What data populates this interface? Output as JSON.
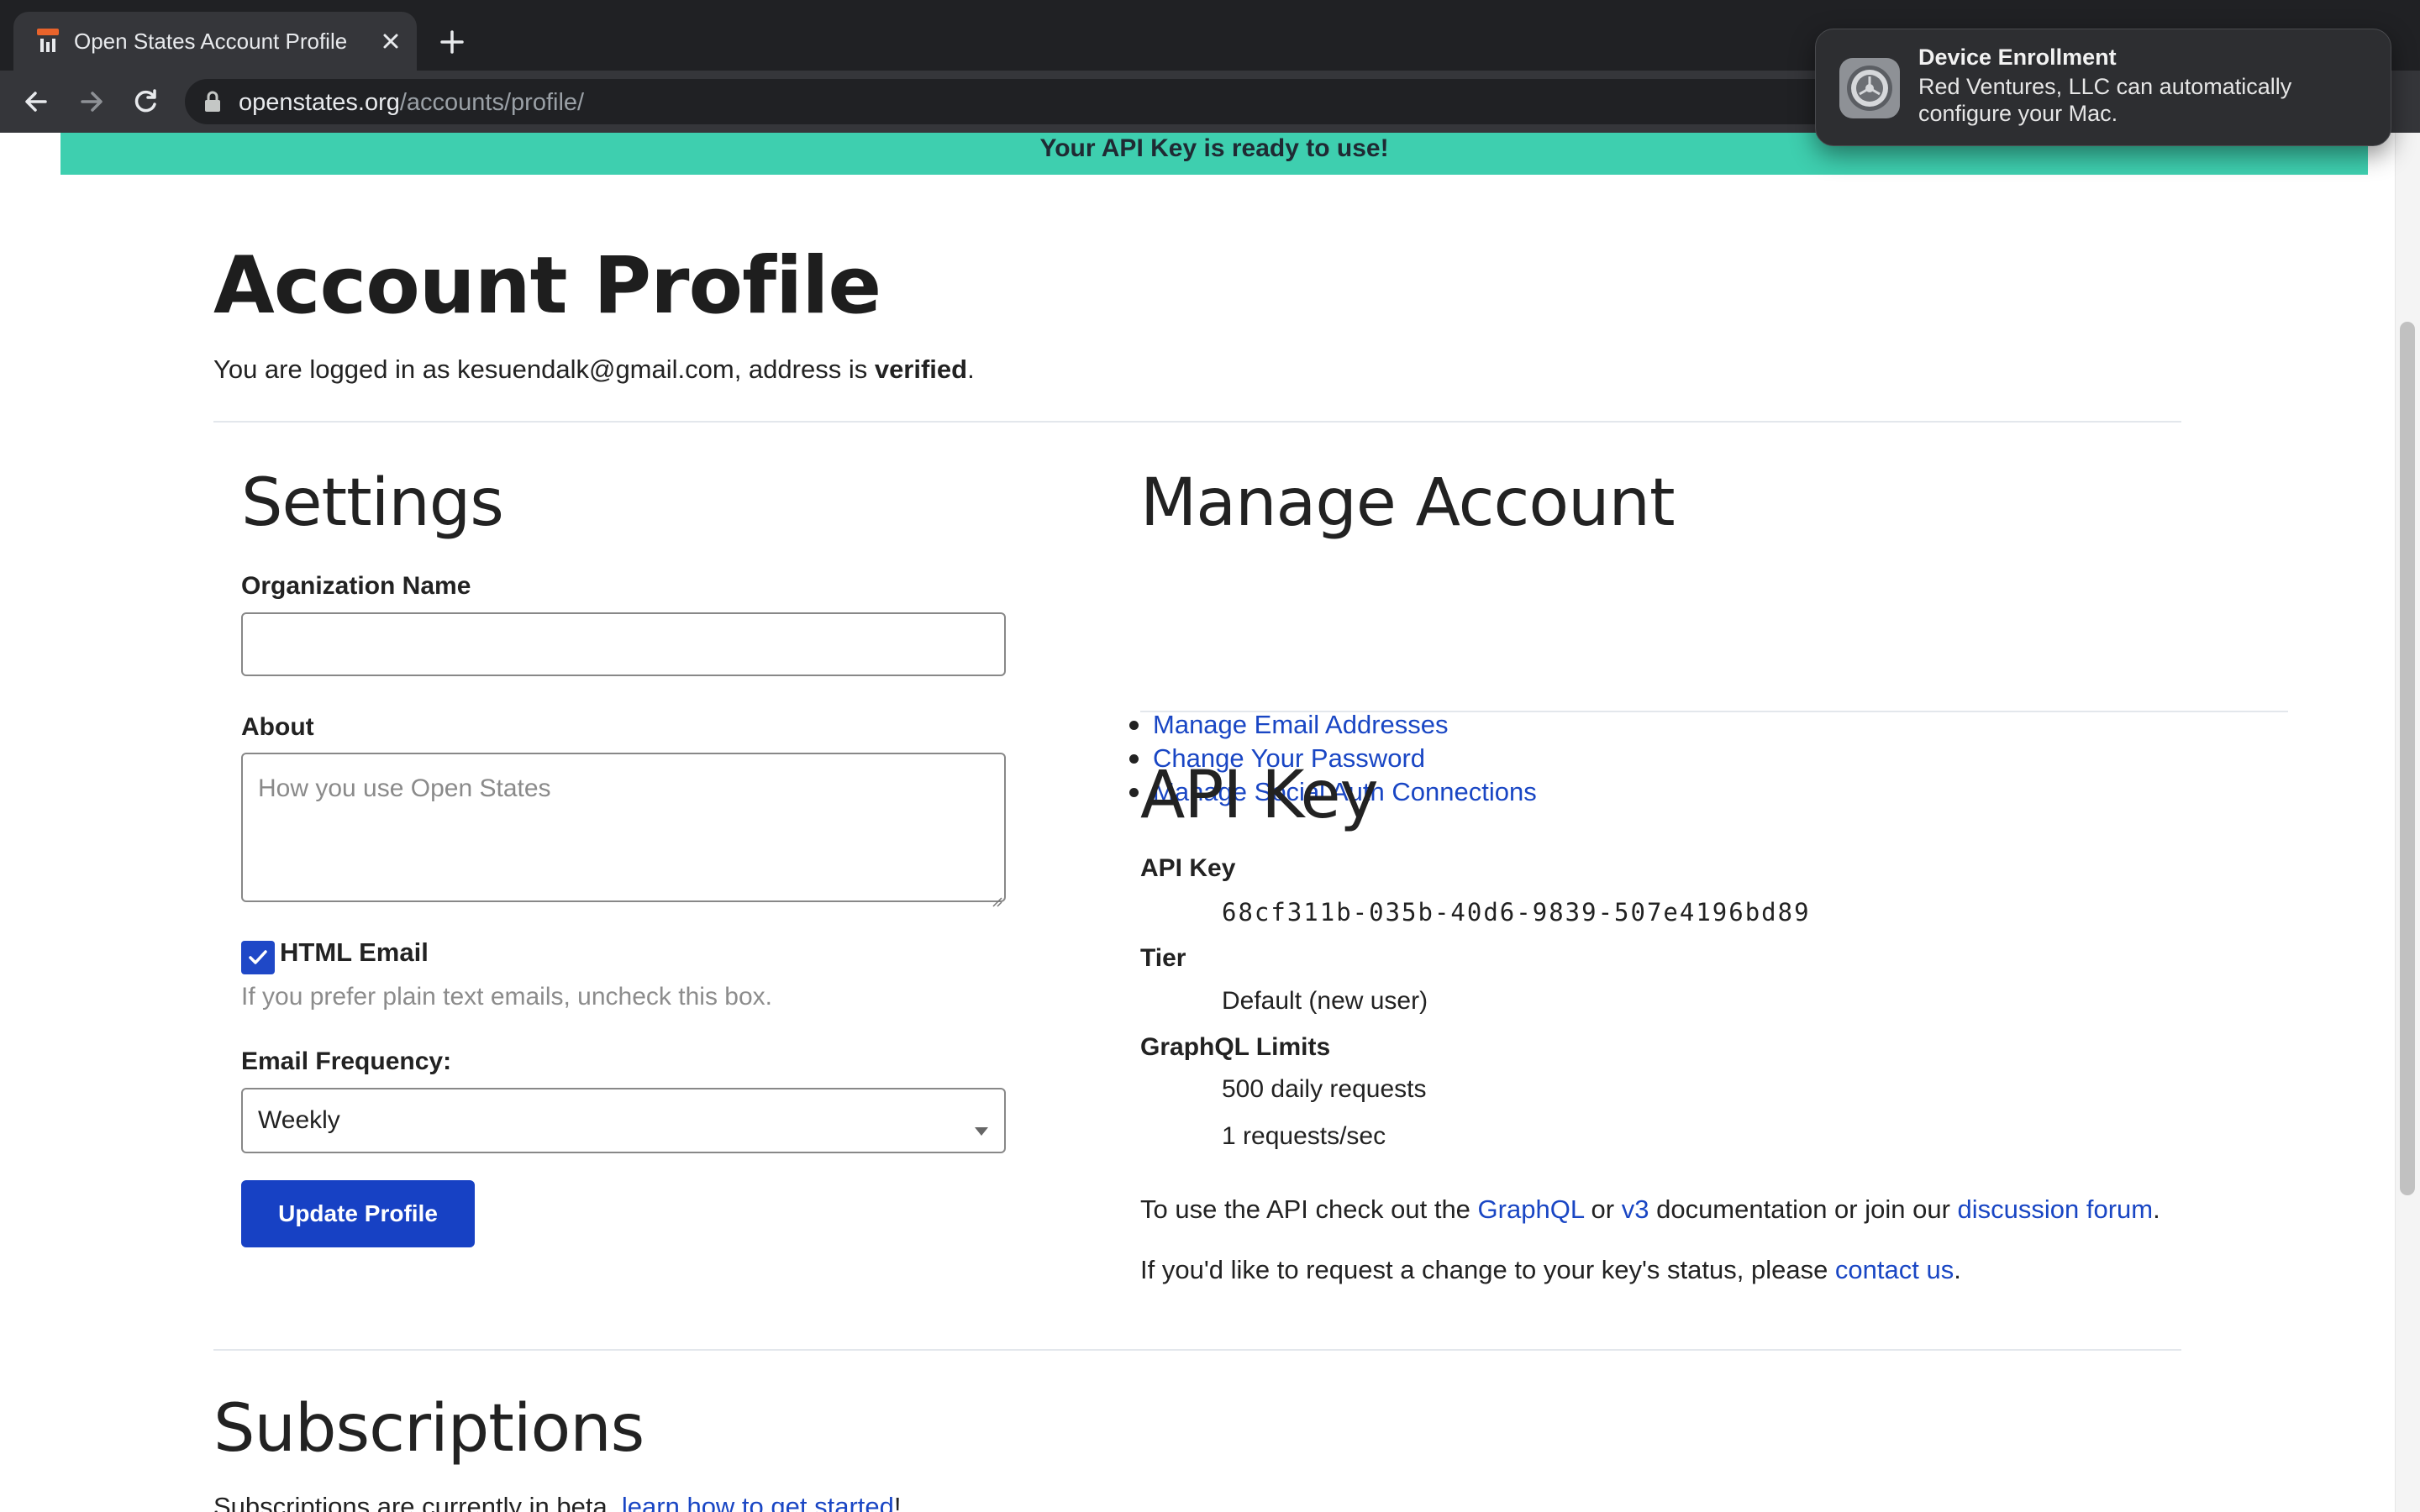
{
  "browser": {
    "tab_title": "Open States Account Profile",
    "url_host": "openstates.org",
    "url_path": "/accounts/profile/"
  },
  "notification": {
    "title": "Device Enrollment",
    "body": "Red Ventures, LLC can automatically configure your Mac."
  },
  "banner": {
    "text": "Your API Key is ready to use!"
  },
  "page": {
    "title": "Account Profile",
    "logged_in_prefix": "You are logged in as kesuendalk@gmail.com, address is ",
    "logged_in_status": "verified",
    "logged_in_suffix": "."
  },
  "settings": {
    "heading": "Settings",
    "org_name_label": "Organization Name",
    "org_name_value": "",
    "about_label": "About",
    "about_placeholder": "How you use Open States",
    "html_email_label": "HTML Email",
    "html_email_checked": true,
    "html_email_help": "If you prefer plain text emails, uncheck this box.",
    "frequency_label": "Email Frequency:",
    "frequency_value": "Weekly",
    "update_button": "Update Profile"
  },
  "manage": {
    "heading": "Manage Account",
    "links": [
      "Manage Email Addresses",
      "Change Your Password",
      "Manage Social Auth Connections"
    ]
  },
  "api": {
    "heading": "API Key",
    "key_label": "API Key",
    "key_value": "68cf311b-035b-40d6-9839-507e4196bd89",
    "tier_label": "Tier",
    "tier_value": "Default (new user)",
    "limits_label": "GraphQL Limits",
    "limit_daily": "500 daily requests",
    "limit_rate": "1 requests/sec",
    "docs_prefix": "To use the API check out the ",
    "docs_graphql": "GraphQL",
    "docs_or": " or ",
    "docs_v3": "v3",
    "docs_mid": " documentation or join our ",
    "docs_forum": "discussion forum",
    "docs_suffix": ".",
    "change_prefix": "If you'd like to request a change to your key's status, please ",
    "change_link": "contact us",
    "change_suffix": "."
  },
  "subscriptions": {
    "heading": "Subscriptions",
    "intro_prefix": "Subscriptions are currently in beta, ",
    "intro_link": "learn how to get started",
    "intro_suffix": "!"
  },
  "colors": {
    "banner": "#3ecfaf",
    "link": "#1946c4",
    "primary_button": "#1741c4",
    "checkbox": "#1f48c7"
  }
}
